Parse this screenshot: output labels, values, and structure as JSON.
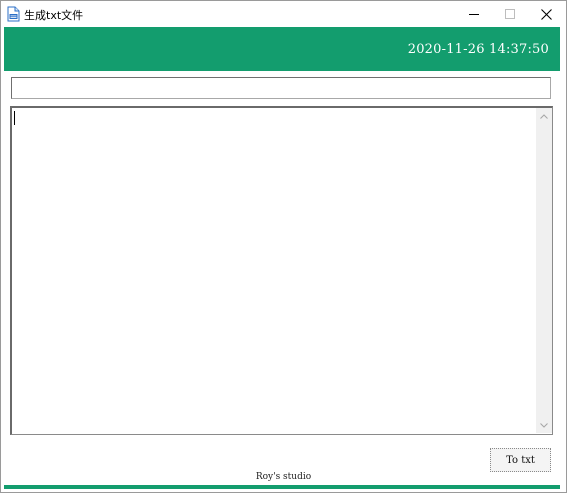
{
  "window": {
    "title": "生成txt文件",
    "controls": {
      "minimize": "minimize-icon",
      "maximize": "maximize-icon",
      "close": "close-icon"
    }
  },
  "header": {
    "datetime": "2020-11-26 14:37:50",
    "color": "#139d6e"
  },
  "path_input": {
    "value": "",
    "placeholder": ""
  },
  "editor": {
    "content": ""
  },
  "actions": {
    "to_txt_label": "To txt"
  },
  "footer": {
    "studio": "Roy's studio"
  }
}
